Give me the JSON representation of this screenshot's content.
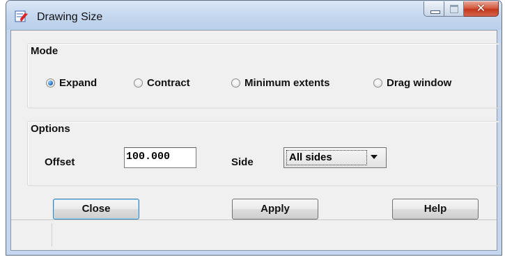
{
  "window": {
    "title": "Drawing Size"
  },
  "mode": {
    "title": "Mode",
    "options": [
      {
        "label": "Expand",
        "checked": true
      },
      {
        "label": "Contract",
        "checked": false
      },
      {
        "label": "Minimum extents",
        "checked": false
      },
      {
        "label": "Drag window",
        "checked": false
      }
    ]
  },
  "options": {
    "title": "Options",
    "offset_label": "Offset",
    "offset_value": "100.000",
    "side_label": "Side",
    "side_value": "All sides"
  },
  "buttons": {
    "close": "Close",
    "apply": "Apply",
    "help": "Help"
  },
  "colors": {
    "accent": "#2b79c7",
    "close_button": "#c3361c"
  },
  "icons": [
    "app-icon",
    "minimize-icon",
    "maximize-icon",
    "close-icon",
    "radio-icon",
    "dropdown-arrow-icon"
  ]
}
